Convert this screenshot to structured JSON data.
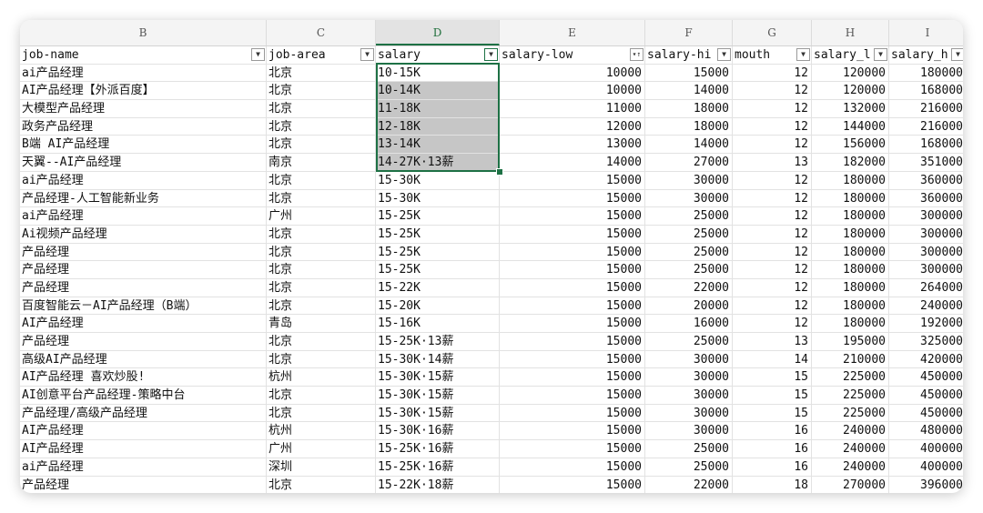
{
  "columns": [
    "B",
    "C",
    "D",
    "E",
    "F",
    "G",
    "H",
    "I"
  ],
  "headers": [
    "job-name",
    "job-area",
    "salary",
    "salary-low",
    "salary-hi",
    "mouth",
    "salary_l",
    "salary_h"
  ],
  "header_icons": [
    "filter-dropdown-icon",
    "filter-dropdown-icon",
    "filter-dropdown-icon",
    "sort-filter-icon",
    "filter-dropdown-icon",
    "filter-dropdown-icon",
    "filter-dropdown-icon",
    "filter-dropdown-icon"
  ],
  "accent_color": "#1e7145",
  "rows": [
    [
      "ai产品经理",
      "北京",
      "10-15K",
      "10000",
      "15000",
      "12",
      "120000",
      "180000"
    ],
    [
      "AI产品经理【外派百度】",
      "北京",
      "10-14K",
      "10000",
      "14000",
      "12",
      "120000",
      "168000"
    ],
    [
      "大模型产品经理",
      "北京",
      "11-18K",
      "11000",
      "18000",
      "12",
      "132000",
      "216000"
    ],
    [
      "政务产品经理",
      "北京",
      "12-18K",
      "12000",
      "18000",
      "12",
      "144000",
      "216000"
    ],
    [
      "B端 AI产品经理",
      "北京",
      "13-14K",
      "13000",
      "14000",
      "12",
      "156000",
      "168000"
    ],
    [
      "天翼--AI产品经理",
      "南京",
      "14-27K·13薪",
      "14000",
      "27000",
      "13",
      "182000",
      "351000"
    ],
    [
      "ai产品经理",
      "北京",
      "15-30K",
      "15000",
      "30000",
      "12",
      "180000",
      "360000"
    ],
    [
      "产品经理-人工智能新业务",
      "北京",
      "15-30K",
      "15000",
      "30000",
      "12",
      "180000",
      "360000"
    ],
    [
      "ai产品经理",
      "广州",
      "15-25K",
      "15000",
      "25000",
      "12",
      "180000",
      "300000"
    ],
    [
      "Ai视频产品经理",
      "北京",
      "15-25K",
      "15000",
      "25000",
      "12",
      "180000",
      "300000"
    ],
    [
      "产品经理",
      "北京",
      "15-25K",
      "15000",
      "25000",
      "12",
      "180000",
      "300000"
    ],
    [
      "产品经理",
      "北京",
      "15-25K",
      "15000",
      "25000",
      "12",
      "180000",
      "300000"
    ],
    [
      "产品经理",
      "北京",
      "15-22K",
      "15000",
      "22000",
      "12",
      "180000",
      "264000"
    ],
    [
      "百度智能云－AI产品经理（B端）",
      "北京",
      "15-20K",
      "15000",
      "20000",
      "12",
      "180000",
      "240000"
    ],
    [
      "AI产品经理",
      "青岛",
      "15-16K",
      "15000",
      "16000",
      "12",
      "180000",
      "192000"
    ],
    [
      "产品经理",
      "北京",
      "15-25K·13薪",
      "15000",
      "25000",
      "13",
      "195000",
      "325000"
    ],
    [
      "高级AI产品经理",
      "北京",
      "15-30K·14薪",
      "15000",
      "30000",
      "14",
      "210000",
      "420000"
    ],
    [
      "AI产品经理 喜欢炒股!",
      "杭州",
      "15-30K·15薪",
      "15000",
      "30000",
      "15",
      "225000",
      "450000"
    ],
    [
      "AI创意平台产品经理-策略中台",
      "北京",
      "15-30K·15薪",
      "15000",
      "30000",
      "15",
      "225000",
      "450000"
    ],
    [
      "产品经理/高级产品经理",
      "北京",
      "15-30K·15薪",
      "15000",
      "30000",
      "15",
      "225000",
      "450000"
    ],
    [
      "AI产品经理",
      "杭州",
      "15-30K·16薪",
      "15000",
      "30000",
      "16",
      "240000",
      "480000"
    ],
    [
      "AI产品经理",
      "广州",
      "15-25K·16薪",
      "15000",
      "25000",
      "16",
      "240000",
      "400000"
    ],
    [
      "ai产品经理",
      "深圳",
      "15-25K·16薪",
      "15000",
      "25000",
      "16",
      "240000",
      "400000"
    ],
    [
      "产品经理",
      "北京",
      "15-22K·18薪",
      "15000",
      "22000",
      "18",
      "270000",
      "396000"
    ]
  ]
}
